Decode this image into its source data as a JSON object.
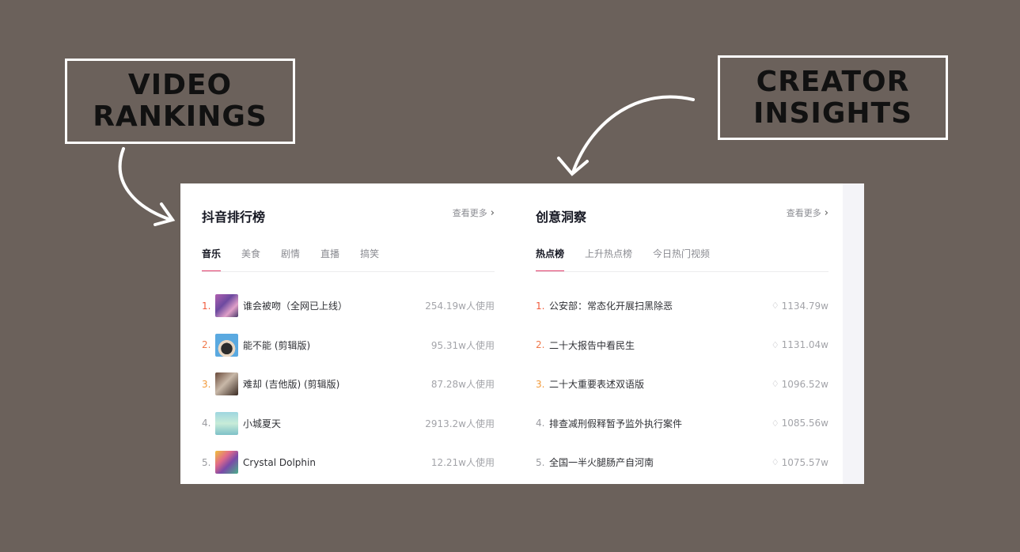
{
  "callouts": {
    "left": {
      "line1": "VIDEO",
      "line2": "RANKINGS"
    },
    "right": {
      "line1": "CREATOR",
      "line2": "INSIGHTS"
    }
  },
  "rankings": {
    "title": "抖音排行榜",
    "see_more": "查看更多",
    "tabs": [
      "音乐",
      "美食",
      "剧情",
      "直播",
      "搞笑"
    ],
    "active_tab": "音乐",
    "items": [
      {
        "rank": "1.",
        "title": "谁会被吻（全网已上线）",
        "value": "254.19w人使用"
      },
      {
        "rank": "2.",
        "title": "能不能 (剪辑版)",
        "value": "95.31w人使用"
      },
      {
        "rank": "3.",
        "title": "难却 (吉他版) (剪辑版)",
        "value": "87.28w人使用"
      },
      {
        "rank": "4.",
        "title": "小城夏天",
        "value": "2913.2w人使用"
      },
      {
        "rank": "5.",
        "title": "Crystal Dolphin",
        "value": "12.21w人使用"
      }
    ]
  },
  "insights": {
    "title": "创意洞察",
    "see_more": "查看更多",
    "tabs": [
      "热点榜",
      "上升热点榜",
      "今日热门视频"
    ],
    "active_tab": "热点榜",
    "items": [
      {
        "rank": "1.",
        "title": "公安部：常态化开展扫黑除恶",
        "value": "1134.79w"
      },
      {
        "rank": "2.",
        "title": "二十大报告中看民生",
        "value": "1131.04w"
      },
      {
        "rank": "3.",
        "title": "二十大重要表述双语版",
        "value": "1096.52w"
      },
      {
        "rank": "4.",
        "title": "排查减刑假释暂予监外执行案件",
        "value": "1085.56w"
      },
      {
        "rank": "5.",
        "title": "全国一半火腿肠产自河南",
        "value": "1075.57w"
      }
    ]
  },
  "icons": {
    "see_more": "chevron-right-icon",
    "heat": "flame-icon"
  },
  "colors": {
    "background": "#6b615b",
    "accent": "#e03a68",
    "rank1": "#f15b3c",
    "rank2": "#f0784a",
    "rank3": "#f29a3a"
  }
}
